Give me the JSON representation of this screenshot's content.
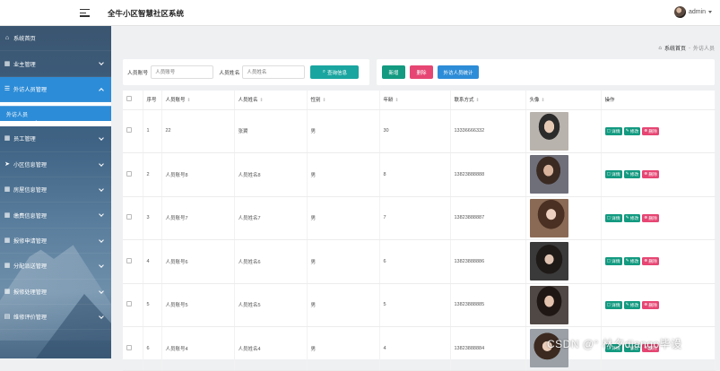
{
  "header": {
    "title": "全牛小区智慧社区系统",
    "user": "admin"
  },
  "sidebar": {
    "items": [
      {
        "label": "系统首页",
        "icon": "home-icon",
        "has_chevron": false
      },
      {
        "label": "业主管理",
        "icon": "grid-icon",
        "has_chevron": true
      },
      {
        "label": "外访人员管理",
        "icon": "list-icon",
        "has_chevron": true,
        "active": true
      },
      {
        "label": "员工管理",
        "icon": "grid-icon",
        "has_chevron": true
      },
      {
        "label": "小区信息管理",
        "icon": "send-icon",
        "has_chevron": true
      },
      {
        "label": "房屋信息管理",
        "icon": "grid-icon",
        "has_chevron": true
      },
      {
        "label": "缴费信息管理",
        "icon": "grid-icon",
        "has_chevron": true
      },
      {
        "label": "报修申请管理",
        "icon": "grid-icon",
        "has_chevron": true
      },
      {
        "label": "分配派送管理",
        "icon": "grid-icon",
        "has_chevron": true
      },
      {
        "label": "报修处理管理",
        "icon": "grid-icon",
        "has_chevron": true
      },
      {
        "label": "维修评价管理",
        "icon": "clipboard-icon",
        "has_chevron": true
      }
    ],
    "sub_item": "外访人员"
  },
  "breadcrumb": {
    "home": "系统首页",
    "separator": "-",
    "current": "外访人员"
  },
  "search": {
    "account_label": "人员账号",
    "account_placeholder": "人员账号",
    "name_label": "人员姓名",
    "name_placeholder": "人员姓名",
    "query_button": "查询信息"
  },
  "actions": {
    "add": "新增",
    "delete": "删除",
    "stats": "外访人员统计"
  },
  "table": {
    "columns": [
      "序号",
      "人员账号",
      "人员姓名",
      "性别",
      "年龄",
      "联系方式",
      "头像",
      "操作"
    ],
    "rows": [
      {
        "index": "1",
        "account": "22",
        "name": "张翼",
        "gender": "男",
        "age": "30",
        "phone": "13336666332"
      },
      {
        "index": "2",
        "account": "人员账号8",
        "name": "人员姓名8",
        "gender": "男",
        "age": "8",
        "phone": "13823888888"
      },
      {
        "index": "3",
        "account": "人员账号7",
        "name": "人员姓名7",
        "gender": "男",
        "age": "7",
        "phone": "13823888887"
      },
      {
        "index": "4",
        "account": "人员账号6",
        "name": "人员姓名6",
        "gender": "男",
        "age": "6",
        "phone": "13823888886"
      },
      {
        "index": "5",
        "account": "人员账号5",
        "name": "人员姓名5",
        "gender": "男",
        "age": "5",
        "phone": "13823888885"
      },
      {
        "index": "6",
        "account": "人员账号4",
        "name": "人员姓名4",
        "gender": "男",
        "age": "4",
        "phone": "13823888884"
      }
    ],
    "op_detail": "详情",
    "op_edit": "修改",
    "op_delete": "删除"
  },
  "watermark": "CSDN @°  林夕django毕设",
  "colors": {
    "sidebar_active": "#2d8cd7",
    "teal_button": "#1aa5a0",
    "green_button": "#139a80",
    "pink_button": "#e64673",
    "blue_button": "#2d8cd7"
  }
}
